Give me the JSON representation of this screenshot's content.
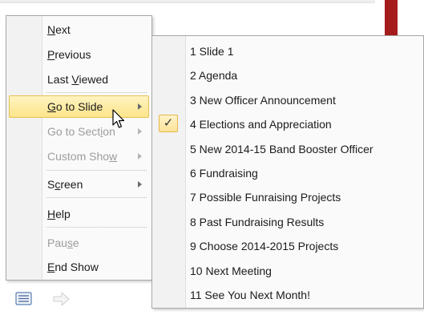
{
  "context_menu": {
    "items": [
      {
        "label": "Next",
        "mnemonic": "N",
        "submenu": false,
        "disabled": false
      },
      {
        "label": "Previous",
        "mnemonic": "P",
        "submenu": false,
        "disabled": false
      },
      {
        "label": "Last Viewed",
        "mnemonic": "V",
        "submenu": false,
        "disabled": false
      },
      {
        "label": "Go to Slide",
        "mnemonic": "G",
        "submenu": true,
        "disabled": false,
        "highlighted": true
      },
      {
        "label": "Go to Section",
        "mnemonic": "i",
        "submenu": true,
        "disabled": true
      },
      {
        "label": "Custom Show",
        "mnemonic": "w",
        "submenu": true,
        "disabled": true
      },
      {
        "label": "Screen",
        "mnemonic": "c",
        "submenu": true,
        "disabled": false
      },
      {
        "label": "Help",
        "mnemonic": "H",
        "submenu": false,
        "disabled": false
      },
      {
        "label": "Pause",
        "mnemonic": "s",
        "submenu": false,
        "disabled": true
      },
      {
        "label": "End Show",
        "mnemonic": "E",
        "submenu": false,
        "disabled": false
      }
    ]
  },
  "slides_submenu": {
    "items": [
      {
        "label": "1 Slide 1",
        "checked": false
      },
      {
        "label": "2 Agenda",
        "checked": false
      },
      {
        "label": "3 New Officer Announcement",
        "checked": false
      },
      {
        "label": "4 Elections and Appreciation",
        "checked": true
      },
      {
        "label": "5 New 2014-15 Band Booster Officer",
        "checked": false
      },
      {
        "label": "6 Fundraising",
        "checked": false
      },
      {
        "label": "7 Possible Funraising Projects",
        "checked": false
      },
      {
        "label": "8 Past Fundraising Results",
        "checked": false
      },
      {
        "label": "9 Choose 2014-2015 Projects",
        "checked": false
      },
      {
        "label": "10 Next Meeting",
        "checked": false
      },
      {
        "label": "11 See You Next Month!",
        "checked": false
      }
    ],
    "check_glyph": "✓"
  },
  "toolbar": {
    "menu_icon": "slide-menu-icon",
    "next_icon": "next-arrow-icon"
  },
  "colors": {
    "highlight": "#fde58a",
    "highlight_border": "#e6c056",
    "disabled_text": "#9c9c9c",
    "background_accent": "#a51c1c"
  }
}
